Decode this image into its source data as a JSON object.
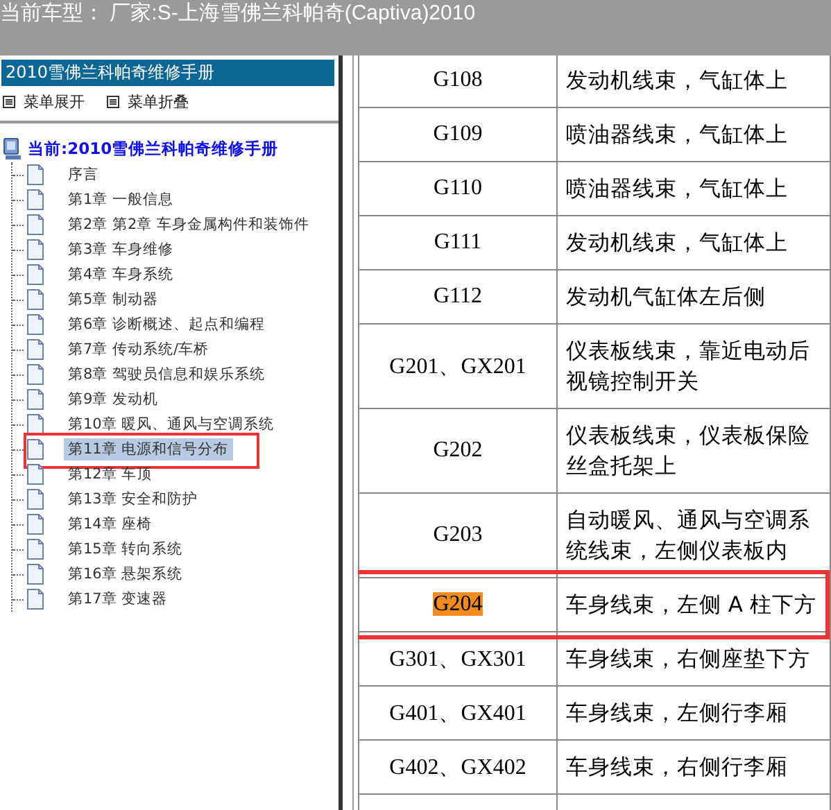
{
  "header": {
    "title": "当前车型： 厂家:S-上海雪佛兰科帕奇(Captiva)2010"
  },
  "sidebar": {
    "title": "2010雪佛兰科帕奇维修手册",
    "menu_actions": [
      "菜单展开",
      "菜单折叠"
    ],
    "root": "当前:2010雪佛兰科帕奇维修手册",
    "items": [
      {
        "label": "序言",
        "selected": false,
        "annotated": false
      },
      {
        "label": "第1章 一般信息",
        "selected": false,
        "annotated": false
      },
      {
        "label": "第2章 第2章 车身金属构件和装饰件",
        "selected": false,
        "annotated": false
      },
      {
        "label": "第3章 车身维修",
        "selected": false,
        "annotated": false
      },
      {
        "label": "第4章 车身系统",
        "selected": false,
        "annotated": false
      },
      {
        "label": "第5章 制动器",
        "selected": false,
        "annotated": false
      },
      {
        "label": "第6章 诊断概述、起点和编程",
        "selected": false,
        "annotated": false
      },
      {
        "label": "第7章 传动系统/车桥",
        "selected": false,
        "annotated": false
      },
      {
        "label": "第8章 驾驶员信息和娱乐系统",
        "selected": false,
        "annotated": false
      },
      {
        "label": "第9章 发动机",
        "selected": false,
        "annotated": false
      },
      {
        "label": "第10章 暖风、通风与空调系统",
        "selected": false,
        "annotated": false
      },
      {
        "label": "第11章 电源和信号分布",
        "selected": true,
        "annotated": true
      },
      {
        "label": "第12章 车顶",
        "selected": false,
        "annotated": false
      },
      {
        "label": "第13章 安全和防护",
        "selected": false,
        "annotated": false
      },
      {
        "label": "第14章 座椅",
        "selected": false,
        "annotated": false
      },
      {
        "label": "第15章 转向系统",
        "selected": false,
        "annotated": false
      },
      {
        "label": "第16章 悬架系统",
        "selected": false,
        "annotated": false
      },
      {
        "label": "第17章 变速器",
        "selected": false,
        "annotated": false
      }
    ]
  },
  "table": {
    "rows": [
      {
        "code": "G108",
        "location": "发动机线束，气缸体上",
        "highlighted": false,
        "annotated": false
      },
      {
        "code": "G109",
        "location": "喷油器线束，气缸体上",
        "highlighted": false,
        "annotated": false
      },
      {
        "code": "G110",
        "location": "喷油器线束，气缸体上",
        "highlighted": false,
        "annotated": false
      },
      {
        "code": "G111",
        "location": "发动机线束，气缸体上",
        "highlighted": false,
        "annotated": false
      },
      {
        "code": "G112",
        "location": "发动机气缸体左后侧",
        "highlighted": false,
        "annotated": false
      },
      {
        "code": "G201、GX201",
        "location": "仪表板线束，靠近电动后视镜控制开关",
        "highlighted": false,
        "annotated": false
      },
      {
        "code": "G202",
        "location": "仪表板线束，仪表板保险丝盒托架上",
        "highlighted": false,
        "annotated": false
      },
      {
        "code": "G203",
        "location": "自动暖风、通风与空调系统线束，左侧仪表板内",
        "highlighted": false,
        "annotated": false
      },
      {
        "code": "G204",
        "location": "车身线束，左侧 A 柱下方",
        "highlighted": true,
        "annotated": true
      },
      {
        "code": "G301、GX301",
        "location": "车身线束，右侧座垫下方",
        "highlighted": false,
        "annotated": false
      },
      {
        "code": "G401、GX401",
        "location": "车身线束，左侧行李厢",
        "highlighted": false,
        "annotated": false
      },
      {
        "code": "G402、GX402",
        "location": "车身线束，右侧行李厢",
        "highlighted": false,
        "annotated": false
      }
    ]
  }
}
